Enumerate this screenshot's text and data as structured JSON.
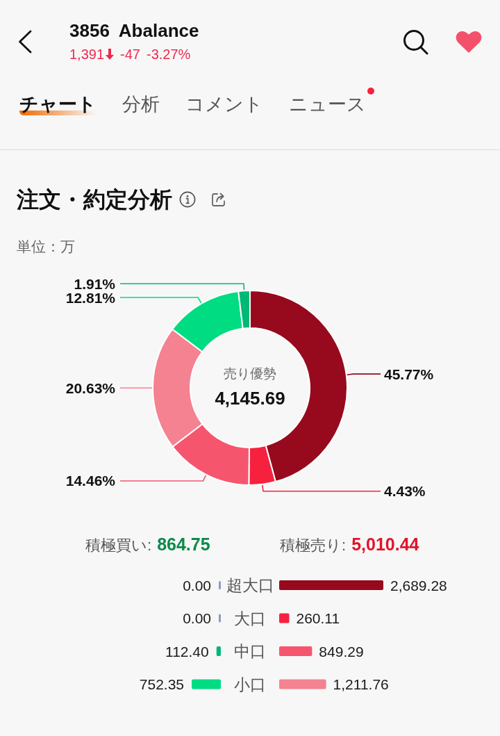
{
  "header": {
    "stock_code": "3856",
    "stock_name": "Abalance",
    "price": "1,391",
    "falling": true,
    "change": "-47",
    "change_percent": "-3.27%",
    "favorite": true
  },
  "tabs": [
    {
      "label": "チャート",
      "selected": true,
      "dot": false
    },
    {
      "label": "分析",
      "selected": false,
      "dot": false
    },
    {
      "label": "コメント",
      "selected": false,
      "dot": false
    },
    {
      "label": "ニュース",
      "selected": false,
      "dot": true
    }
  ],
  "section": {
    "title": "注文・約定分析",
    "unit": "単位：万"
  },
  "donut": {
    "center_label": "売り優勢",
    "center_value": "4,145.69",
    "chart_data": {
      "type": "donut",
      "values": [
        45.77,
        4.43,
        14.46,
        20.63,
        12.81,
        1.91
      ],
      "value_labels": [
        "45.77%",
        "4.43%",
        "14.46%",
        "20.63%",
        "12.81%",
        "1.91%"
      ],
      "colors": [
        "#970a1e",
        "#f6213f",
        "#f5566e",
        "#f48291",
        "#00dc82",
        "#00b875"
      ]
    }
  },
  "summary": [
    {
      "label": "積極買い:",
      "value": "864.75",
      "color": "#0b8a4a"
    },
    {
      "label": "積極売り:",
      "value": "5,010.44",
      "color": "#e2142b"
    }
  ],
  "buy_side": [
    {
      "value": "0.00",
      "color": "#8e9bc2"
    },
    {
      "value": "0.00",
      "color": "#8e9bc2"
    },
    {
      "value": "112.40",
      "color": "#00b875"
    },
    {
      "value": "752.35",
      "color": "#00dc82"
    }
  ],
  "sell_bars": {
    "chart_data": {
      "type": "bar",
      "orientation": "horizontal",
      "categories": [
        "超大口",
        "大口",
        "中口",
        "小口"
      ],
      "values": [
        2689.28,
        260.11,
        849.29,
        1211.76
      ],
      "value_labels": [
        "2,689.28",
        "260.11",
        "849.29",
        "1,211.76"
      ],
      "colors": [
        "#970a1e",
        "#f6213f",
        "#f5566e",
        "#f48291"
      ]
    }
  }
}
